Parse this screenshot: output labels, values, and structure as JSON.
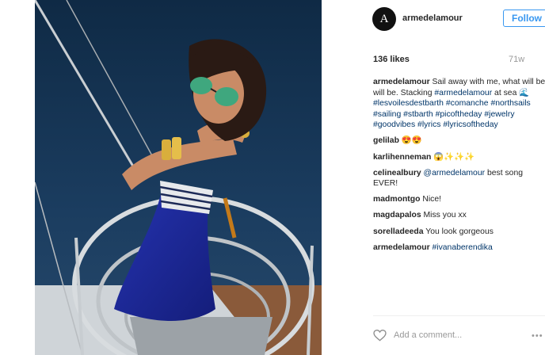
{
  "header": {
    "avatar_letter": "A",
    "username": "armedelamour",
    "follow_label": "Follow"
  },
  "post": {
    "likes": "136 likes",
    "time": "71w"
  },
  "comments": [
    {
      "author": "armedelamour",
      "parts": [
        {
          "t": "text",
          "v": " Sail away with me, what will be will be. Stacking "
        },
        {
          "t": "tag",
          "v": "#armedelamour"
        },
        {
          "t": "text",
          "v": " at sea 🌊 "
        },
        {
          "t": "tag",
          "v": "#lesvoilesdestbarth"
        },
        {
          "t": "text",
          "v": " "
        },
        {
          "t": "tag",
          "v": "#comanche"
        },
        {
          "t": "text",
          "v": " "
        },
        {
          "t": "tag",
          "v": "#northsails"
        },
        {
          "t": "text",
          "v": " "
        },
        {
          "t": "tag",
          "v": "#sailing"
        },
        {
          "t": "text",
          "v": " "
        },
        {
          "t": "tag",
          "v": "#stbarth"
        },
        {
          "t": "text",
          "v": " "
        },
        {
          "t": "tag",
          "v": "#picoftheday"
        },
        {
          "t": "text",
          "v": " "
        },
        {
          "t": "tag",
          "v": "#jewelry"
        },
        {
          "t": "text",
          "v": " "
        },
        {
          "t": "tag",
          "v": "#goodvibes"
        },
        {
          "t": "text",
          "v": " "
        },
        {
          "t": "tag",
          "v": "#lyrics"
        },
        {
          "t": "text",
          "v": " "
        },
        {
          "t": "tag",
          "v": "#lyricsoftheday"
        }
      ]
    },
    {
      "author": "gelilab",
      "parts": [
        {
          "t": "text",
          "v": " 😍😍"
        }
      ]
    },
    {
      "author": "karlihenneman",
      "parts": [
        {
          "t": "text",
          "v": " 😱✨✨✨"
        }
      ]
    },
    {
      "author": "celinealbury",
      "parts": [
        {
          "t": "text",
          "v": " "
        },
        {
          "t": "tag",
          "v": "@armedelamour"
        },
        {
          "t": "text",
          "v": " best song EVER!"
        }
      ]
    },
    {
      "author": "madmontgo",
      "parts": [
        {
          "t": "text",
          "v": " Nice!"
        }
      ]
    },
    {
      "author": "magdapalos",
      "parts": [
        {
          "t": "text",
          "v": " Miss you xx"
        }
      ]
    },
    {
      "author": "sorelladeeda",
      "parts": [
        {
          "t": "text",
          "v": " You look gorgeous"
        }
      ]
    },
    {
      "author": "armedelamour",
      "parts": [
        {
          "t": "text",
          "v": " "
        },
        {
          "t": "tag",
          "v": "#ivanaberendika"
        }
      ]
    }
  ],
  "add_comment": {
    "placeholder": "Add a comment...",
    "more": "•••"
  },
  "icons": {
    "like": "heart-icon",
    "more": "more-options-icon"
  },
  "colors": {
    "follow_blue": "#3897f0",
    "tag_blue": "#003569",
    "sea": "#17324f",
    "dress": "#1e2b9e"
  }
}
